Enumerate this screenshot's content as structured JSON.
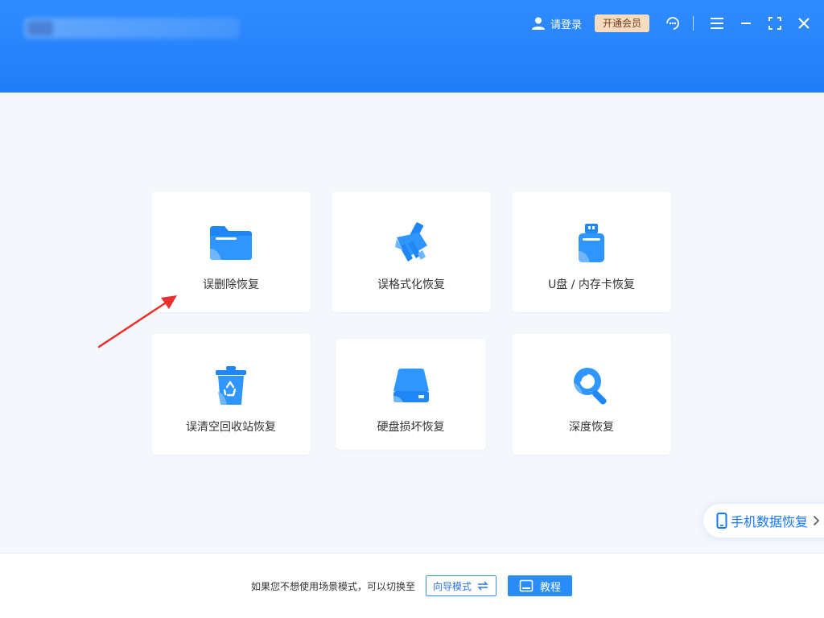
{
  "header": {
    "login_label": "请登录",
    "vip_label": "开通会员"
  },
  "cards": [
    {
      "label": "误删除恢复",
      "icon": "folder-icon"
    },
    {
      "label": "误格式化恢复",
      "icon": "broom-icon"
    },
    {
      "label": "U盘 / 内存卡恢复",
      "icon": "usb-drive-icon"
    },
    {
      "label": "误清空回收站恢复",
      "icon": "recycle-bin-icon"
    },
    {
      "label": "硬盘损坏恢复",
      "icon": "hard-drive-icon"
    },
    {
      "label": "深度恢复",
      "icon": "deep-scan-icon"
    }
  ],
  "mobile": {
    "label": "手机数据恢复"
  },
  "footer": {
    "hint": "如果您不想使用场景模式，可以切换至",
    "guide_label": "向导模式",
    "tutorial_label": "教程"
  },
  "colors": {
    "header_blue": "#2f8cff",
    "accent": "#1677ff",
    "vip_bg": "#f8dcc2",
    "arrow_red": "#e8312f"
  }
}
